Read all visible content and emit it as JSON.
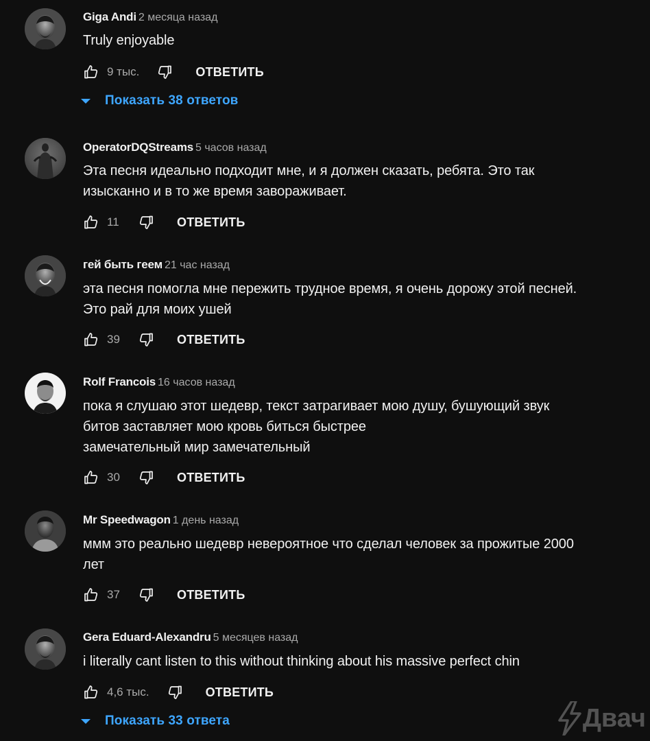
{
  "ui": {
    "reply_label": "ОТВЕТИТЬ",
    "icons": {
      "like": "thumb-up-icon",
      "dislike": "thumb-down-icon",
      "expand": "caret-down-icon"
    },
    "colors": {
      "background": "#0f0f0f",
      "text": "#f1f1f1",
      "secondary": "#aaaaaa",
      "link": "#3ea6ff"
    }
  },
  "comments": [
    {
      "author": "Giga Andi",
      "time": "2 месяца назад",
      "text": [
        "Truly enjoyable"
      ],
      "likes": "9 тыс.",
      "replies_label": "Показать 38 ответов"
    },
    {
      "author": "OperatorDQStreams",
      "time": "5 часов назад",
      "text": [
        "Эта песня идеально подходит мне, и я должен сказать, ребята. Это так",
        "изысканно и в то же время завораживает."
      ],
      "likes": "11"
    },
    {
      "author": "гей быть геем",
      "time": "21 час назад",
      "text": [
        "эта песня помогла мне пережить трудное время, я очень дорожу этой песней.",
        "Это рай для моих ушей"
      ],
      "likes": "39"
    },
    {
      "author": "Rolf Francois",
      "time": "16 часов назад",
      "text": [
        "пока я слушаю этот шедевр, текст затрагивает мою душу, бушующий звук",
        "битов заставляет мою кровь биться быстрее",
        "замечательный мир замечательный"
      ],
      "likes": "30"
    },
    {
      "author": "Mr Speedwagon",
      "time": "1 день назад",
      "text": [
        "ммм это реально шедевр невероятное что сделал человек за прожитые 2000",
        "лет"
      ],
      "likes": "37"
    },
    {
      "author": "Gera Eduard-Alexandru",
      "time": "5 месяцев назад",
      "text": [
        "i literally cant listen to this without thinking about his massive perfect chin"
      ],
      "likes": "4,6 тыс.",
      "replies_label": "Показать 33 ответа"
    }
  ],
  "watermark": {
    "text": "Двач",
    "icon": "lightning-bolt-icon"
  }
}
